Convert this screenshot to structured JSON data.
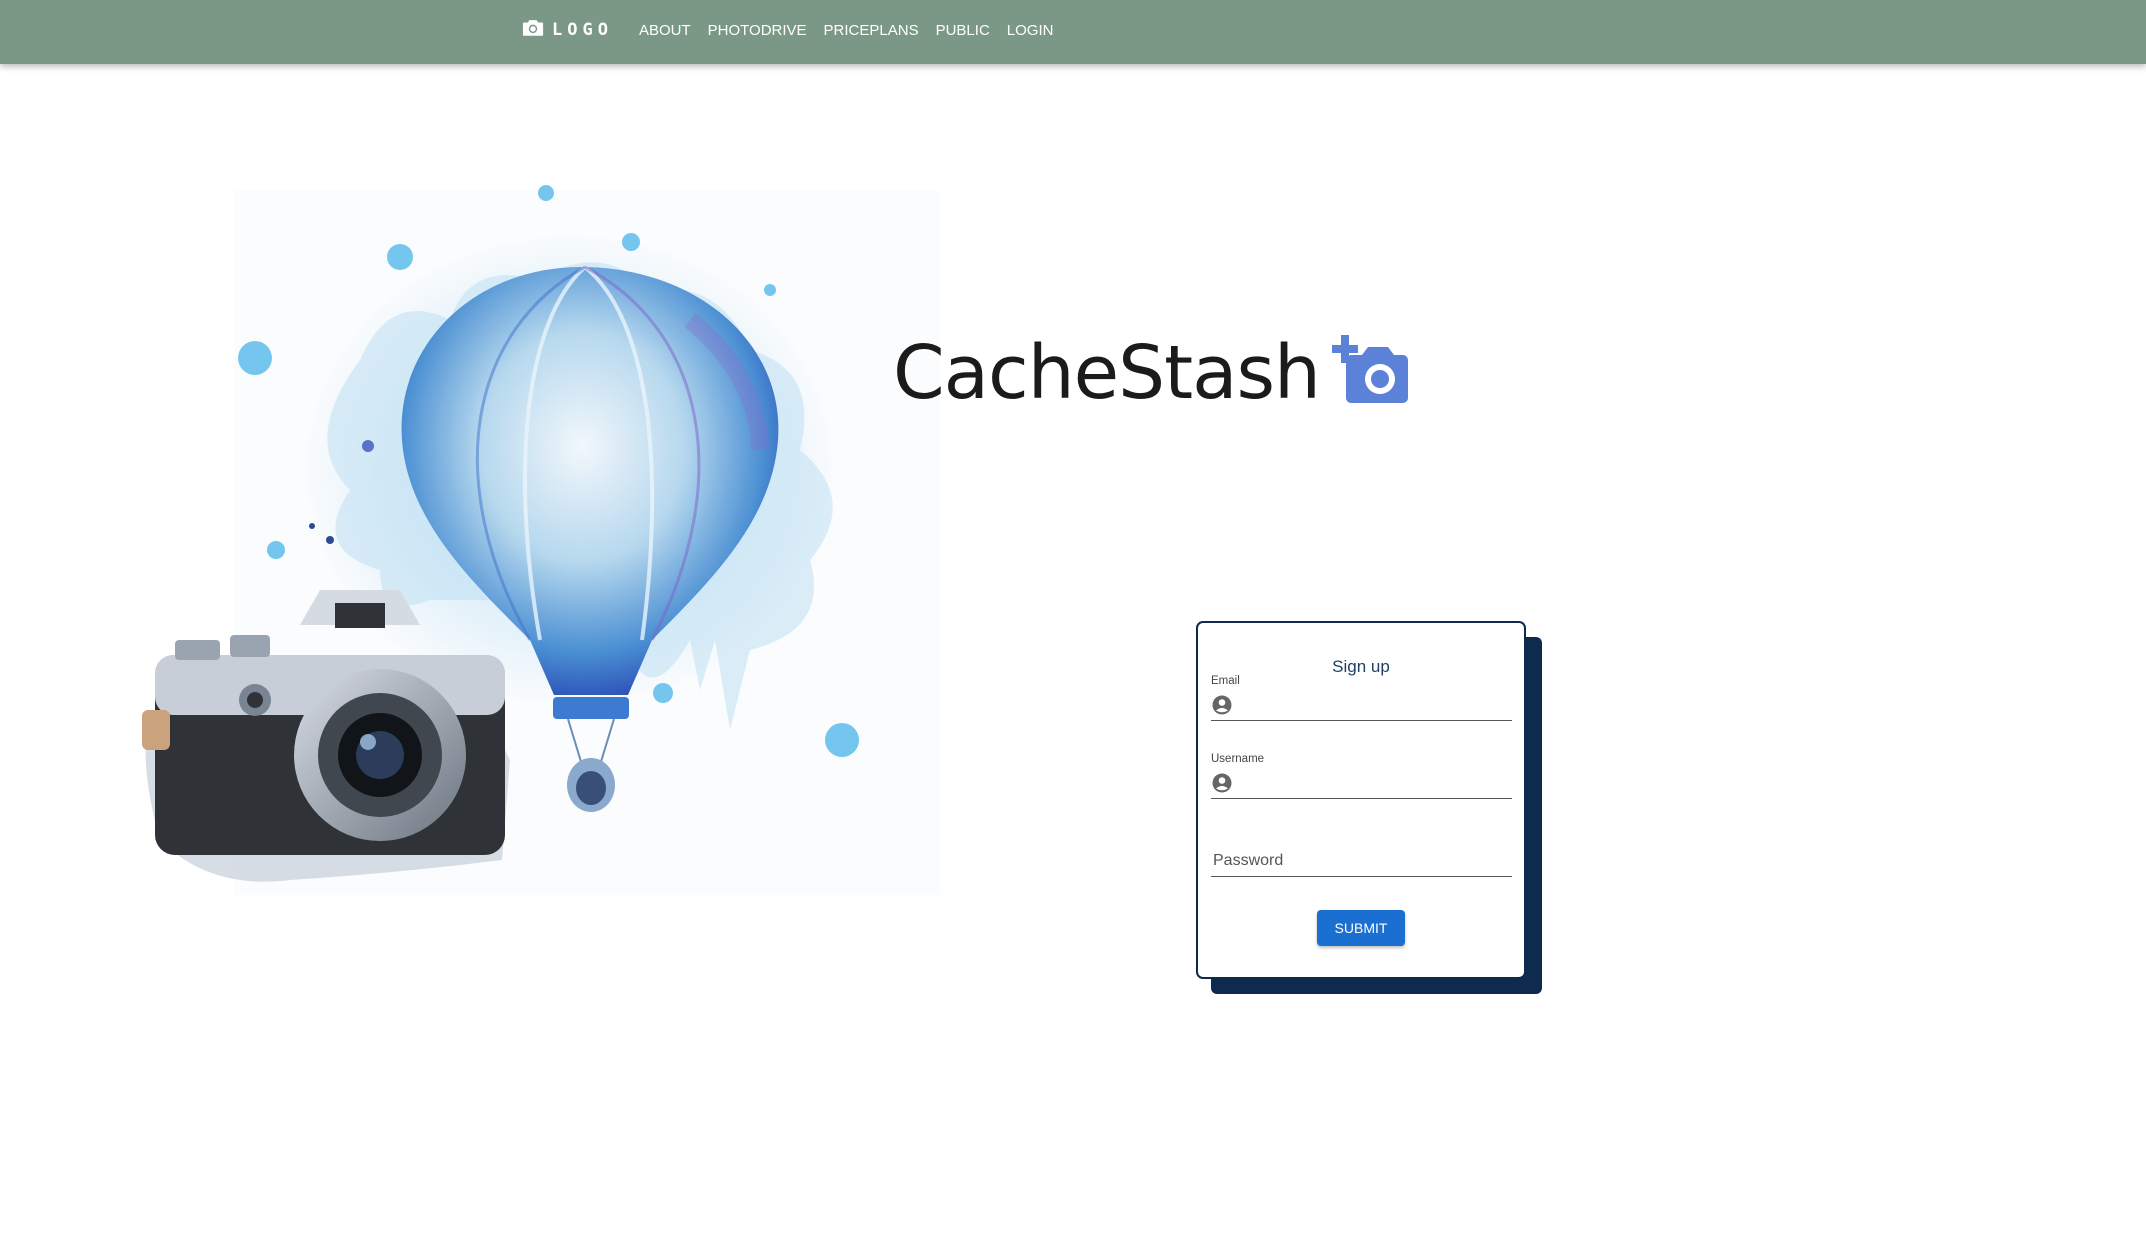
{
  "nav": {
    "logo_text": "LOGO",
    "links": [
      "ABOUT",
      "PHOTODRIVE",
      "PRICEPLANS",
      "PUBLIC",
      "LOGIN"
    ]
  },
  "brand": {
    "name": "CacheStash",
    "icon": "add-photo-icon"
  },
  "signup": {
    "title": "Sign up",
    "email_label": "Email",
    "email_value": "",
    "username_label": "Username",
    "username_value": "",
    "password_placeholder": "Password",
    "submit_label": "SUBMIT"
  },
  "colors": {
    "navbar": "#7b9886",
    "card_border": "#0f2a4f",
    "submit_button": "#1b6fd1",
    "brand_icon": "#5b82d6"
  }
}
